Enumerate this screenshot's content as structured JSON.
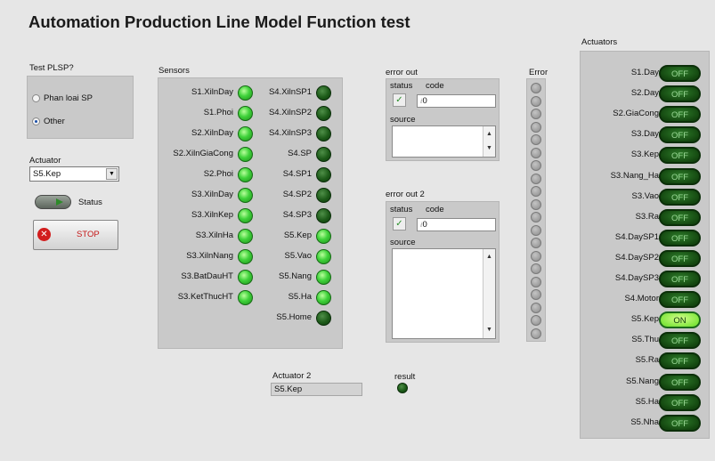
{
  "title": "Automation Production Line Model Function test",
  "test_plsp": {
    "label": "Test PLSP?",
    "options": [
      {
        "label": "Phan loai SP",
        "selected": false
      },
      {
        "label": "Other",
        "selected": true
      }
    ]
  },
  "actuator": {
    "label": "Actuator",
    "value": "S5.Kep"
  },
  "status_toggle": {
    "label": "Status"
  },
  "stop_button": {
    "label": "STOP"
  },
  "sensors": {
    "label": "Sensors",
    "left": [
      {
        "name": "S1.XilnDay",
        "on": true
      },
      {
        "name": "S1.Phoi",
        "on": true
      },
      {
        "name": "S2.XilnDay",
        "on": true
      },
      {
        "name": "S2.XilnGiaCong",
        "on": true
      },
      {
        "name": "S2.Phoi",
        "on": true
      },
      {
        "name": "S3.XilnDay",
        "on": true
      },
      {
        "name": "S3.XilnKep",
        "on": true
      },
      {
        "name": "S3.XilnHa",
        "on": true
      },
      {
        "name": "S3.XilnNang",
        "on": true
      },
      {
        "name": "S3.BatDauHT",
        "on": true
      },
      {
        "name": "S3.KetThucHT",
        "on": true
      }
    ],
    "right": [
      {
        "name": "S4.XilnSP1",
        "on": false
      },
      {
        "name": "S4.XilnSP2",
        "on": false
      },
      {
        "name": "S4.XilnSP3",
        "on": false
      },
      {
        "name": "S4.SP",
        "on": false
      },
      {
        "name": "S4.SP1",
        "on": false
      },
      {
        "name": "S4.SP2",
        "on": false
      },
      {
        "name": "S4.SP3",
        "on": false
      },
      {
        "name": "S5.Kep",
        "on": true
      },
      {
        "name": "S5.Vao",
        "on": true
      },
      {
        "name": "S5.Nang",
        "on": true
      },
      {
        "name": "S5.Ha",
        "on": true
      },
      {
        "name": "S5.Home",
        "on": false
      }
    ]
  },
  "error_out": {
    "label": "error out",
    "status_label": "status",
    "code_label": "code",
    "code_value": "0",
    "source_label": "source",
    "source_value": ""
  },
  "error_out_2": {
    "label": "error out 2",
    "status_label": "status",
    "code_label": "code",
    "code_value": "0",
    "source_label": "source",
    "source_value": ""
  },
  "error_array": {
    "label": "Error",
    "count": 20
  },
  "actuator_2": {
    "label": "Actuator 2",
    "value": "S5.Kep"
  },
  "result": {
    "label": "result",
    "on": false
  },
  "actuators": {
    "label": "Actuators",
    "items": [
      {
        "name": "S1.Day",
        "state": "OFF"
      },
      {
        "name": "S2.Day",
        "state": "OFF"
      },
      {
        "name": "S2.GiaCong",
        "state": "OFF"
      },
      {
        "name": "S3.Day",
        "state": "OFF"
      },
      {
        "name": "S3.Kep",
        "state": "OFF"
      },
      {
        "name": "S3.Nang_Ha",
        "state": "OFF"
      },
      {
        "name": "S3.Vao",
        "state": "OFF"
      },
      {
        "name": "S3.Ra",
        "state": "OFF"
      },
      {
        "name": "S4.DaySP1",
        "state": "OFF"
      },
      {
        "name": "S4.DaySP2",
        "state": "OFF"
      },
      {
        "name": "S4.DaySP3",
        "state": "OFF"
      },
      {
        "name": "S4.Motor",
        "state": "OFF"
      },
      {
        "name": "S5.Kep",
        "state": "ON"
      },
      {
        "name": "S5.Thu",
        "state": "OFF"
      },
      {
        "name": "S5.Ra",
        "state": "OFF"
      },
      {
        "name": "S5.Nang",
        "state": "OFF"
      },
      {
        "name": "S5.Ha",
        "state": "OFF"
      },
      {
        "name": "S5.Nha",
        "state": "OFF"
      }
    ]
  }
}
